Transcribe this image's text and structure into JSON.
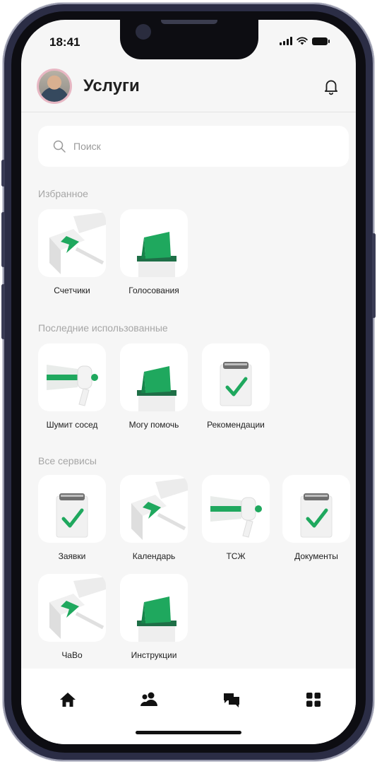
{
  "status_bar": {
    "time": "18:41"
  },
  "header": {
    "title": "Услуги"
  },
  "search": {
    "placeholder": "Поиск"
  },
  "sections": {
    "favorites": {
      "title": "Избранное",
      "items": [
        {
          "label": "Счетчики",
          "icon": "arrow-box-icon"
        },
        {
          "label": "Голосования",
          "icon": "ballot-box-icon"
        }
      ]
    },
    "recent": {
      "title": "Последние использованные",
      "items": [
        {
          "label": "Шумит сосед",
          "icon": "megaphone-icon"
        },
        {
          "label": "Могу помочь",
          "icon": "ballot-box-icon"
        },
        {
          "label": "Рекомендации",
          "icon": "clipboard-check-icon"
        }
      ]
    },
    "all": {
      "title": "Все сервисы",
      "items": [
        {
          "label": "Заявки",
          "icon": "clipboard-check-icon"
        },
        {
          "label": "Календарь",
          "icon": "arrow-box-icon"
        },
        {
          "label": "ТСЖ",
          "icon": "megaphone-icon"
        },
        {
          "label": "Документы",
          "icon": "clipboard-check-icon"
        },
        {
          "label": "ЧаВо",
          "icon": "arrow-box-icon"
        },
        {
          "label": "Инструкции",
          "icon": "ballot-box-icon"
        }
      ]
    }
  },
  "bottom_nav": [
    {
      "icon": "home-icon"
    },
    {
      "icon": "users-icon"
    },
    {
      "icon": "chat-icon"
    },
    {
      "icon": "grid-icon"
    }
  ],
  "colors": {
    "accent": "#1fa85e",
    "background": "#f6f6f6",
    "tile": "#ffffff"
  }
}
